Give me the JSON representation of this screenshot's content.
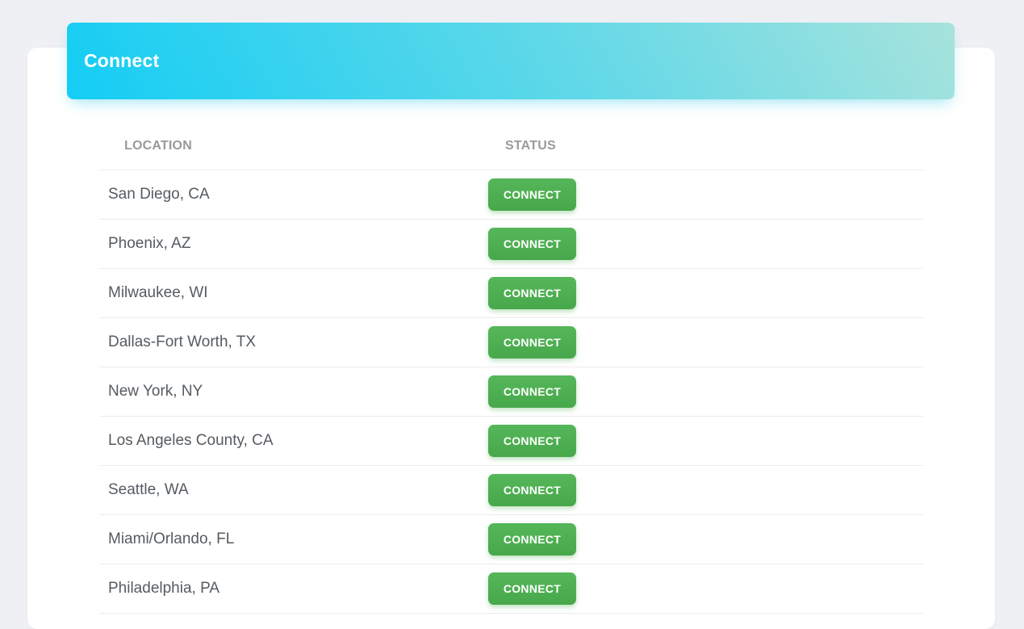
{
  "card": {
    "title": "Connect"
  },
  "table": {
    "headers": {
      "location": "LOCATION",
      "status": "STATUS"
    },
    "rows": [
      {
        "location": "San Diego, CA",
        "action": "CONNECT"
      },
      {
        "location": "Phoenix, AZ",
        "action": "CONNECT"
      },
      {
        "location": "Milwaukee, WI",
        "action": "CONNECT"
      },
      {
        "location": "Dallas-Fort Worth, TX",
        "action": "CONNECT"
      },
      {
        "location": "New York, NY",
        "action": "CONNECT"
      },
      {
        "location": "Los Angeles County, CA",
        "action": "CONNECT"
      },
      {
        "location": "Seattle, WA",
        "action": "CONNECT"
      },
      {
        "location": "Miami/Orlando, FL",
        "action": "CONNECT"
      },
      {
        "location": "Philadelphia, PA",
        "action": "CONNECT"
      }
    ]
  },
  "colors": {
    "header_gradient_start": "#14cdf4",
    "header_gradient_end": "#a7e3dc",
    "connect_button": "#4caf50",
    "background": "#eff0f4"
  }
}
